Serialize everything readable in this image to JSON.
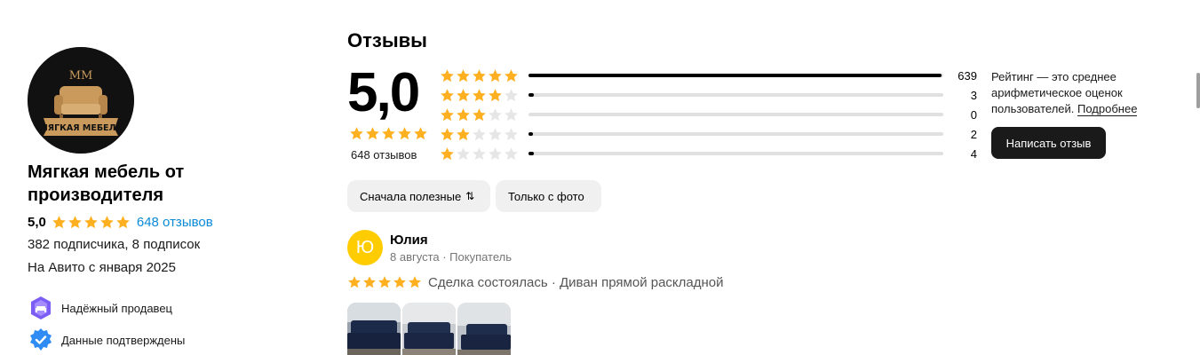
{
  "seller": {
    "logo_text": "МЯГКАЯ МЕБЕЛЬ",
    "logo_monogram": "MM",
    "name": "Мягкая мебель от производителя",
    "rating": "5,0",
    "rating_stars": 5,
    "reviews_link": "648 отзывов",
    "subscribers": "382 подписчика, 8 подписок",
    "since": "На Авито с января 2025",
    "badges": [
      {
        "icon": "reliable-seller-icon",
        "label": "Надёжный продавец",
        "color": "#7b5cf5"
      },
      {
        "icon": "verified-check-icon",
        "label": "Данные подтверждены",
        "color": "#2f8cf5"
      }
    ]
  },
  "reviews": {
    "title": "Отзывы",
    "average": "5,0",
    "total_label": "648 отзывов",
    "distribution": [
      {
        "stars": 5,
        "count": "639",
        "share": 0.995
      },
      {
        "stars": 4,
        "count": "3",
        "share": 0.012
      },
      {
        "stars": 3,
        "count": "0",
        "share": 0
      },
      {
        "stars": 2,
        "count": "2",
        "share": 0.008
      },
      {
        "stars": 1,
        "count": "4",
        "share": 0.012
      }
    ],
    "info_text": "Рейтинг — это среднее арифметическое оценок пользователей.",
    "info_link": "Подробнее",
    "write_button": "Написать отзыв",
    "filters": {
      "sort_label": "Сначала полезные",
      "sort_icon": "sort-arrows-icon",
      "photo_only_label": "Только с фото"
    },
    "items": [
      {
        "avatar_letter": "Ю",
        "author": "Юлия",
        "meta": "8 августа · Покупатель",
        "stars": 5,
        "deal": "Сделка состоялась · Диван прямой раскладной",
        "photos": [
          "sofa-photo-1",
          "sofa-photo-2",
          "sofa-photo-3"
        ]
      }
    ]
  },
  "colors": {
    "star_active": "#ffb021",
    "star_inactive": "#e6e6e6",
    "link": "#0a8ad6",
    "avatar_bg": "#ffcc00",
    "dark_button": "#1a1a1a"
  }
}
